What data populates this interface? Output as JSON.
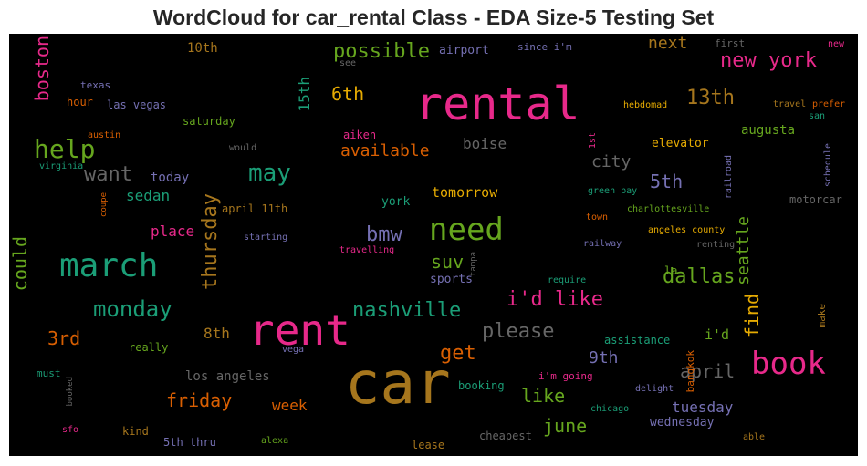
{
  "title": "WordCloud for car_rental Class - EDA Size-5 Testing Set",
  "chart_data": {
    "type": "wordcloud",
    "background": "#000000",
    "words": [
      {
        "text": "car",
        "size": 64,
        "color": "#a6761d",
        "vertical": false
      },
      {
        "text": "rental",
        "size": 50,
        "color": "#e7298a",
        "vertical": false
      },
      {
        "text": "rent",
        "size": 46,
        "color": "#e7298a",
        "vertical": false
      },
      {
        "text": "march",
        "size": 36,
        "color": "#1b9e77",
        "vertical": false
      },
      {
        "text": "book",
        "size": 34,
        "color": "#e7298a",
        "vertical": false
      },
      {
        "text": "need",
        "size": 34,
        "color": "#66a61e",
        "vertical": false
      },
      {
        "text": "help",
        "size": 28,
        "color": "#66a61e",
        "vertical": false
      },
      {
        "text": "may",
        "size": 26,
        "color": "#1b9e77",
        "vertical": false
      },
      {
        "text": "monday",
        "size": 24,
        "color": "#1b9e77",
        "vertical": false
      },
      {
        "text": "possible",
        "size": 22,
        "color": "#66a61e",
        "vertical": false
      },
      {
        "text": "nashville",
        "size": 22,
        "color": "#1b9e77",
        "vertical": false
      },
      {
        "text": "please",
        "size": 22,
        "color": "#666666",
        "vertical": false
      },
      {
        "text": "new york",
        "size": 22,
        "color": "#e7298a",
        "vertical": false
      },
      {
        "text": "i'd like",
        "size": 22,
        "color": "#e7298a",
        "vertical": false
      },
      {
        "text": "dallas",
        "size": 22,
        "color": "#66a61e",
        "vertical": false
      },
      {
        "text": "want",
        "size": 22,
        "color": "#666666",
        "vertical": false
      },
      {
        "text": "13th",
        "size": 22,
        "color": "#a6761d",
        "vertical": false
      },
      {
        "text": "bmw",
        "size": 22,
        "color": "#7570b3",
        "vertical": false
      },
      {
        "text": "get",
        "size": 22,
        "color": "#d95f02",
        "vertical": false
      },
      {
        "text": "april",
        "size": 20,
        "color": "#666666",
        "vertical": false
      },
      {
        "text": "6th",
        "size": 20,
        "color": "#e6ab02",
        "vertical": false
      },
      {
        "text": "friday",
        "size": 20,
        "color": "#d95f02",
        "vertical": false
      },
      {
        "text": "suv",
        "size": 20,
        "color": "#66a61e",
        "vertical": false
      },
      {
        "text": "5th",
        "size": 20,
        "color": "#7570b3",
        "vertical": false
      },
      {
        "text": "3rd",
        "size": 20,
        "color": "#d95f02",
        "vertical": false
      },
      {
        "text": "like",
        "size": 20,
        "color": "#66a61e",
        "vertical": false
      },
      {
        "text": "june",
        "size": 20,
        "color": "#66a61e",
        "vertical": false
      },
      {
        "text": "next",
        "size": 18,
        "color": "#a6761d",
        "vertical": false
      },
      {
        "text": "available",
        "size": 18,
        "color": "#d95f02",
        "vertical": false
      },
      {
        "text": "9th",
        "size": 18,
        "color": "#7570b3",
        "vertical": false
      },
      {
        "text": "city",
        "size": 18,
        "color": "#666666",
        "vertical": false
      },
      {
        "text": "tuesday",
        "size": 16,
        "color": "#7570b3",
        "vertical": false
      },
      {
        "text": "boise",
        "size": 16,
        "color": "#666666",
        "vertical": false
      },
      {
        "text": "week",
        "size": 16,
        "color": "#d95f02",
        "vertical": false
      },
      {
        "text": "8th",
        "size": 16,
        "color": "#a6761d",
        "vertical": false
      },
      {
        "text": "sedan",
        "size": 16,
        "color": "#1b9e77",
        "vertical": false
      },
      {
        "text": "place",
        "size": 16,
        "color": "#e7298a",
        "vertical": false
      },
      {
        "text": "tomorrow",
        "size": 15,
        "color": "#e6ab02",
        "vertical": false
      },
      {
        "text": "i'd",
        "size": 15,
        "color": "#66a61e",
        "vertical": false
      },
      {
        "text": "augusta",
        "size": 14,
        "color": "#66a61e",
        "vertical": false
      },
      {
        "text": "los angeles",
        "size": 14,
        "color": "#666666",
        "vertical": false
      },
      {
        "text": "10th",
        "size": 14,
        "color": "#a6761d",
        "vertical": false
      },
      {
        "text": "today",
        "size": 14,
        "color": "#7570b3",
        "vertical": false
      },
      {
        "text": "wednesday",
        "size": 13,
        "color": "#7570b3",
        "vertical": false
      },
      {
        "text": "sports",
        "size": 13,
        "color": "#7570b3",
        "vertical": false
      },
      {
        "text": "airport",
        "size": 13,
        "color": "#7570b3",
        "vertical": false
      },
      {
        "text": "elevator",
        "size": 13,
        "color": "#e6ab02",
        "vertical": false
      },
      {
        "text": "york",
        "size": 13,
        "color": "#1b9e77",
        "vertical": false
      },
      {
        "text": "la",
        "size": 12,
        "color": "#66a61e",
        "vertical": false
      },
      {
        "text": "assistance",
        "size": 12,
        "color": "#1b9e77",
        "vertical": false
      },
      {
        "text": "booking",
        "size": 12,
        "color": "#1b9e77",
        "vertical": false
      },
      {
        "text": "really",
        "size": 12,
        "color": "#66a61e",
        "vertical": false
      },
      {
        "text": "saturday",
        "size": 12,
        "color": "#66a61e",
        "vertical": false
      },
      {
        "text": "cheapest",
        "size": 12,
        "color": "#666666",
        "vertical": false
      },
      {
        "text": "hour",
        "size": 12,
        "color": "#d95f02",
        "vertical": false
      },
      {
        "text": "las vegas",
        "size": 12,
        "color": "#7570b3",
        "vertical": false
      },
      {
        "text": "april 11th",
        "size": 12,
        "color": "#a6761d",
        "vertical": false
      },
      {
        "text": "motorcar",
        "size": 12,
        "color": "#666666",
        "vertical": false
      },
      {
        "text": "kind",
        "size": 12,
        "color": "#a6761d",
        "vertical": false
      },
      {
        "text": "5th thru",
        "size": 12,
        "color": "#7570b3",
        "vertical": false
      },
      {
        "text": "lease",
        "size": 12,
        "color": "#a6761d",
        "vertical": false
      },
      {
        "text": "aiken",
        "size": 12,
        "color": "#e7298a",
        "vertical": false
      },
      {
        "text": "texas",
        "size": 11,
        "color": "#7570b3",
        "vertical": false
      },
      {
        "text": "must",
        "size": 11,
        "color": "#1b9e77",
        "vertical": false
      },
      {
        "text": "since i'm",
        "size": 11,
        "color": "#7570b3",
        "vertical": false
      },
      {
        "text": "i'm going",
        "size": 11,
        "color": "#e7298a",
        "vertical": false
      },
      {
        "text": "first",
        "size": 11,
        "color": "#666666",
        "vertical": false
      },
      {
        "text": "angeles county",
        "size": 10,
        "color": "#e6ab02",
        "vertical": false
      },
      {
        "text": "alexa",
        "size": 10,
        "color": "#66a61e",
        "vertical": false
      },
      {
        "text": "would",
        "size": 10,
        "color": "#666666",
        "vertical": false
      },
      {
        "text": "hebdomad",
        "size": 10,
        "color": "#e6ab02",
        "vertical": false
      },
      {
        "text": "charlottesville",
        "size": 10,
        "color": "#66a61e",
        "vertical": false
      },
      {
        "text": "railway",
        "size": 10,
        "color": "#7570b3",
        "vertical": false
      },
      {
        "text": "renting",
        "size": 10,
        "color": "#666666",
        "vertical": false
      },
      {
        "text": "travel",
        "size": 10,
        "color": "#a6761d",
        "vertical": false
      },
      {
        "text": "prefer",
        "size": 10,
        "color": "#d95f02",
        "vertical": false
      },
      {
        "text": "travelling",
        "size": 10,
        "color": "#e7298a",
        "vertical": false
      },
      {
        "text": "starting",
        "size": 10,
        "color": "#7570b3",
        "vertical": false
      },
      {
        "text": "require",
        "size": 10,
        "color": "#1b9e77",
        "vertical": false
      },
      {
        "text": "delight",
        "size": 10,
        "color": "#7570b3",
        "vertical": false
      },
      {
        "text": "chicago",
        "size": 10,
        "color": "#1b9e77",
        "vertical": false
      },
      {
        "text": "able",
        "size": 10,
        "color": "#a6761d",
        "vertical": false
      },
      {
        "text": "vega",
        "size": 10,
        "color": "#7570b3",
        "vertical": false
      },
      {
        "text": "sfo",
        "size": 10,
        "color": "#e7298a",
        "vertical": false
      },
      {
        "text": "new",
        "size": 10,
        "color": "#e7298a",
        "vertical": false
      },
      {
        "text": "see",
        "size": 10,
        "color": "#666666",
        "vertical": false
      },
      {
        "text": "austin",
        "size": 10,
        "color": "#d95f02",
        "vertical": false
      },
      {
        "text": "virginia",
        "size": 10,
        "color": "#1b9e77",
        "vertical": false
      },
      {
        "text": "green bay",
        "size": 10,
        "color": "#1b9e77",
        "vertical": false
      },
      {
        "text": "town",
        "size": 10,
        "color": "#d95f02",
        "vertical": false
      },
      {
        "text": "san",
        "size": 10,
        "color": "#1b9e77",
        "vertical": false
      },
      {
        "text": "boston",
        "size": 20,
        "color": "#e7298a",
        "vertical": true
      },
      {
        "text": "thursday",
        "size": 22,
        "color": "#a6761d",
        "vertical": true
      },
      {
        "text": "could",
        "size": 20,
        "color": "#66a61e",
        "vertical": true
      },
      {
        "text": "find",
        "size": 20,
        "color": "#e6ab02",
        "vertical": true
      },
      {
        "text": "seattle",
        "size": 18,
        "color": "#66a61e",
        "vertical": true
      },
      {
        "text": "15th",
        "size": 16,
        "color": "#1b9e77",
        "vertical": true
      },
      {
        "text": "bangkok",
        "size": 11,
        "color": "#d95f02",
        "vertical": true
      },
      {
        "text": "make",
        "size": 11,
        "color": "#a6761d",
        "vertical": true
      },
      {
        "text": "1st",
        "size": 10,
        "color": "#e7298a",
        "vertical": true
      },
      {
        "text": "schedule",
        "size": 10,
        "color": "#7570b3",
        "vertical": true
      },
      {
        "text": "railroad",
        "size": 10,
        "color": "#7570b3",
        "vertical": true
      },
      {
        "text": "coupe",
        "size": 9,
        "color": "#d95f02",
        "vertical": true
      },
      {
        "text": "booked",
        "size": 9,
        "color": "#666666",
        "vertical": true
      },
      {
        "text": "tampa",
        "size": 9,
        "color": "#666666",
        "vertical": true
      }
    ]
  }
}
